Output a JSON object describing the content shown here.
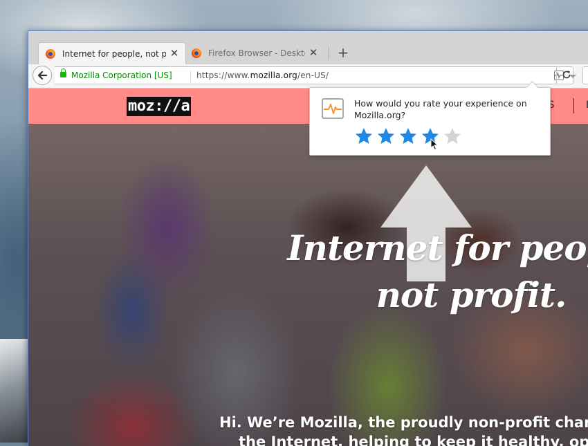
{
  "browser": {
    "tabs": [
      {
        "title": "Internet for people, not profit",
        "active": true,
        "icon": "firefox-icon"
      },
      {
        "title": "Firefox Browser - Desktop...",
        "active": false,
        "icon": "firefox-icon"
      }
    ],
    "new_tab_label": "+",
    "close_glyph": "✕",
    "identity_label": "Mozilla Corporation [US]",
    "url_prefix": "https://www.",
    "url_domain": "mozilla.org",
    "url_path": "/en-US/"
  },
  "site": {
    "logo_text": "moz://a",
    "nav_partial_1": "NS",
    "nav_partial_2": "I",
    "hero_title_line1": "Internet for people,",
    "hero_title_line2": "not profit.",
    "intro_line1": "Hi. We’re Mozilla, the proudly non-profit champ",
    "intro_line2": "the Internet, helping to keep it healthy, open"
  },
  "rating_popup": {
    "question": "How would you rate your experience on Mozilla.org?",
    "max_stars": 5,
    "selected_stars": 4
  },
  "colors": {
    "header_bg": "#ff8a86",
    "star_active": "#1e88e5",
    "star_inactive": "#d4d4d4",
    "identity_green": "#058b00",
    "pulse_orange": "#f09633"
  }
}
